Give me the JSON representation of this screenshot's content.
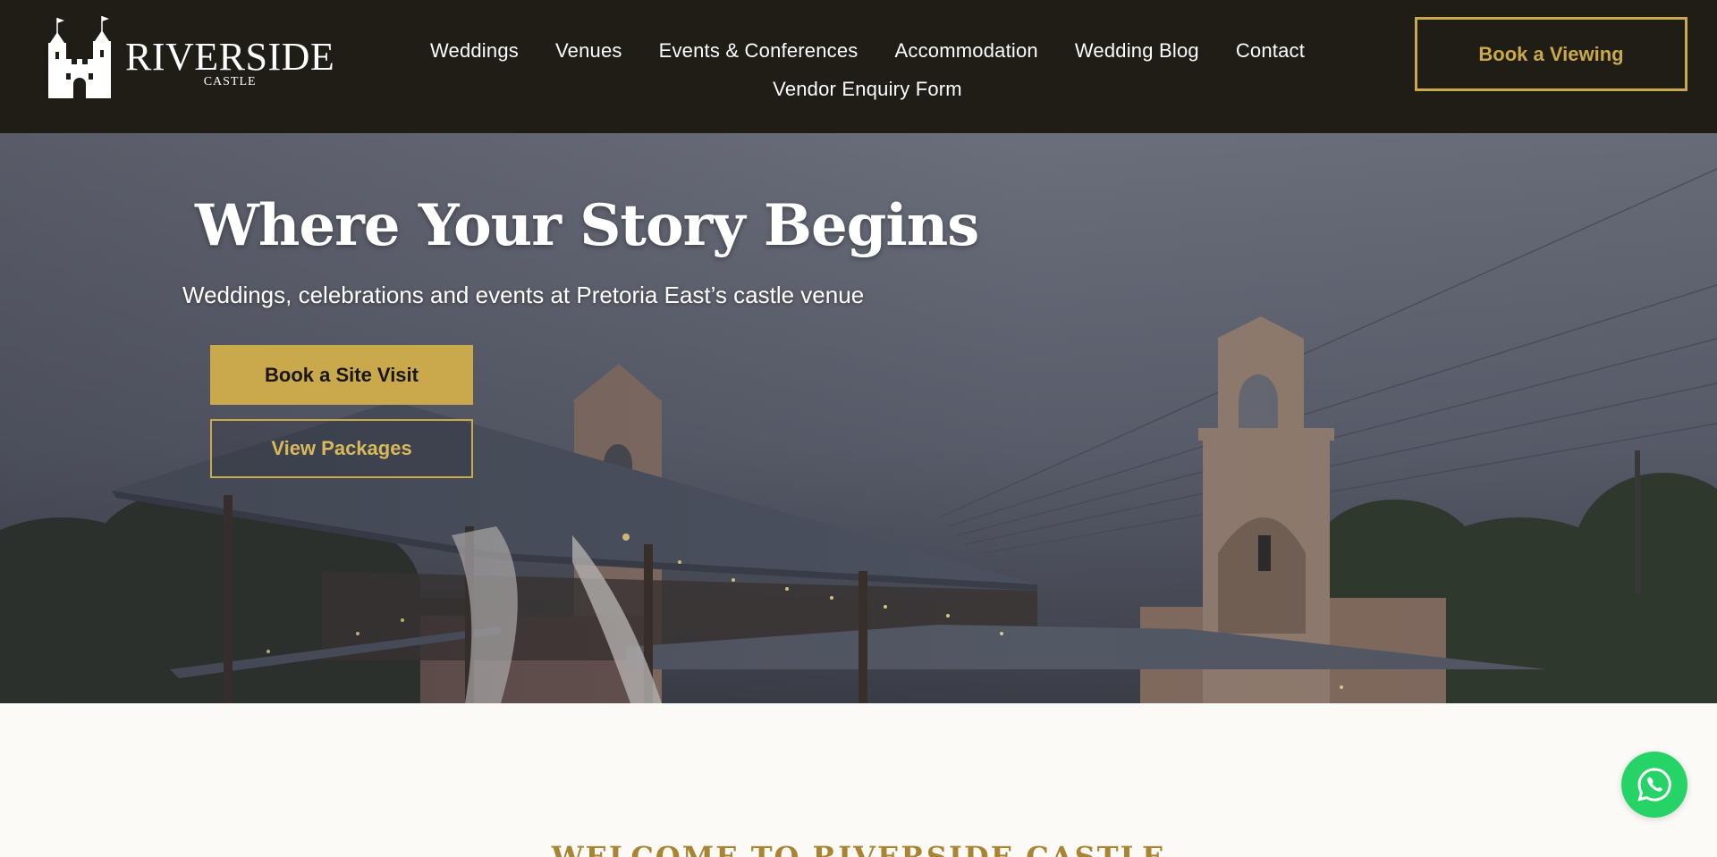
{
  "brand": {
    "name_main": "RIVERSIDE",
    "name_sub": "CASTLE",
    "logo_icon": "castle-icon"
  },
  "nav": {
    "items": [
      "Weddings",
      "Venues",
      "Events & Conferences",
      "Accommodation",
      "Wedding Blog",
      "Contact"
    ],
    "items_row2": [
      "Vendor Enquiry Form"
    ]
  },
  "header": {
    "cta_label": "Book a Viewing"
  },
  "hero": {
    "title": "Where Your Story Begins",
    "subtitle": "Weddings, celebrations and events at Pretoria East’s castle venue",
    "primary_cta": "Book a Site Visit",
    "secondary_cta": "View Packages"
  },
  "welcome": {
    "heading": "WELCOME TO RIVERSIDE CASTLE"
  },
  "floating": {
    "whatsapp_icon": "whatsapp-icon"
  },
  "colors": {
    "header_bg": "#201c16",
    "accent_gold": "#c9a94c",
    "whatsapp_green": "#25d366",
    "page_bg": "#fbfaf6",
    "welcome_text": "#a98433"
  }
}
